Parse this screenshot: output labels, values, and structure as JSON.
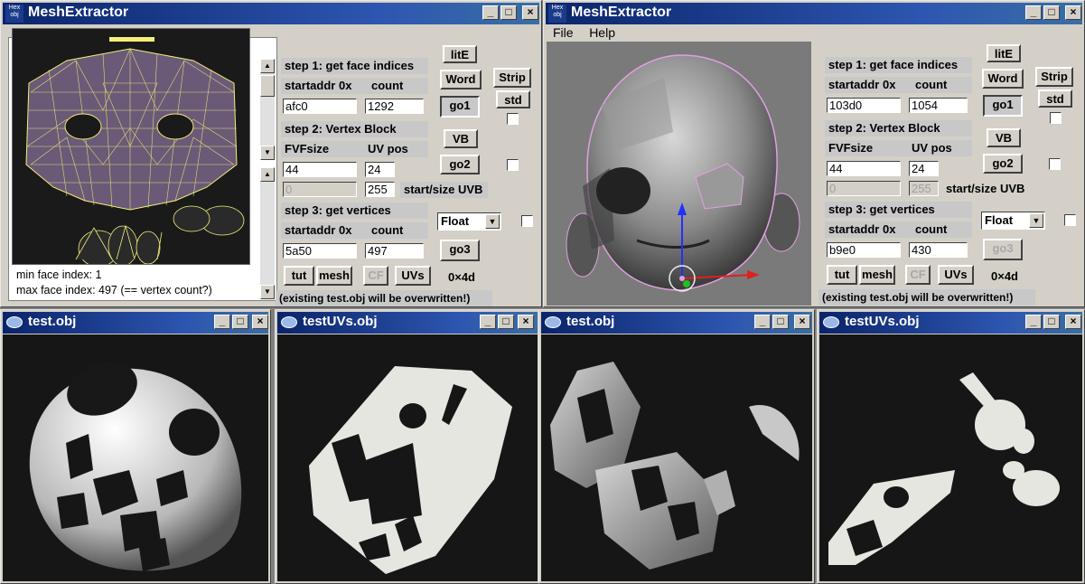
{
  "left_app": {
    "title": "MeshExtractor",
    "icon_text": "Hex obj",
    "litE": "litE",
    "word": "Word",
    "strip": "Strip",
    "std": "std",
    "step1": "step 1: get face indices",
    "startaddr_label": "startaddr 0x",
    "count_label": "count",
    "startaddr": "afc0",
    "count": "1292",
    "go1": "go1",
    "vb": "VB",
    "step2": "step 2: Vertex Block",
    "fvf_label": "FVFsize",
    "uvpos_label": "UV pos",
    "fvf": "44",
    "uvpos": "24",
    "go2": "go2",
    "uvb_start": "0",
    "uvb_size": "255",
    "startsize_label": "start/size UVB",
    "step3": "step 3: get vertices",
    "startaddr3": "5a50",
    "count3": "497",
    "go3": "go3",
    "float": "Float",
    "tut": "tut",
    "mesh": "mesh",
    "cf": "CF",
    "uvs": "UVs",
    "hex": "0×4d",
    "status1": "min face index: 1",
    "status2": "max face index: 497 (== vertex count?)",
    "warning": "(existing test.obj will be overwritten!)"
  },
  "right_app": {
    "title": "MeshExtractor",
    "icon_text": "Hex obj",
    "menu_file": "File",
    "menu_help": "Help",
    "litE": "litE",
    "word": "Word",
    "strip": "Strip",
    "std": "std",
    "step1": "step 1: get face indices",
    "startaddr_label": "startaddr 0x",
    "count_label": "count",
    "startaddr": "103d0",
    "count": "1054",
    "go1": "go1",
    "vb": "VB",
    "step2": "step 2: Vertex Block",
    "fvf_label": "FVFsize",
    "uvpos_label": "UV pos",
    "fvf": "44",
    "uvpos": "24",
    "go2": "go2",
    "uvb_start": "0",
    "uvb_size": "255",
    "startsize_label": "start/size UVB",
    "step3": "step 3: get vertices",
    "startaddr3": "b9e0",
    "count3": "430",
    "go3": "go3",
    "float": "Float",
    "tut": "tut",
    "mesh": "mesh",
    "cf": "CF",
    "uvs": "UVs",
    "hex": "0×4d",
    "warning": "(existing test.obj will be overwritten!)"
  },
  "viewers": {
    "w1_title": "test.obj",
    "w2_title": "testUVs.obj",
    "w3_title": "test.obj",
    "w4_title": "testUVs.obj"
  },
  "titlebar_buttons": {
    "minimize": "_",
    "maximize": "□",
    "close": "×"
  },
  "colors": {
    "title_active": "#0a246a",
    "face_fill": "#e6e6e0",
    "wire": "#f5f07a",
    "wire_bg": "#6a5a78"
  }
}
